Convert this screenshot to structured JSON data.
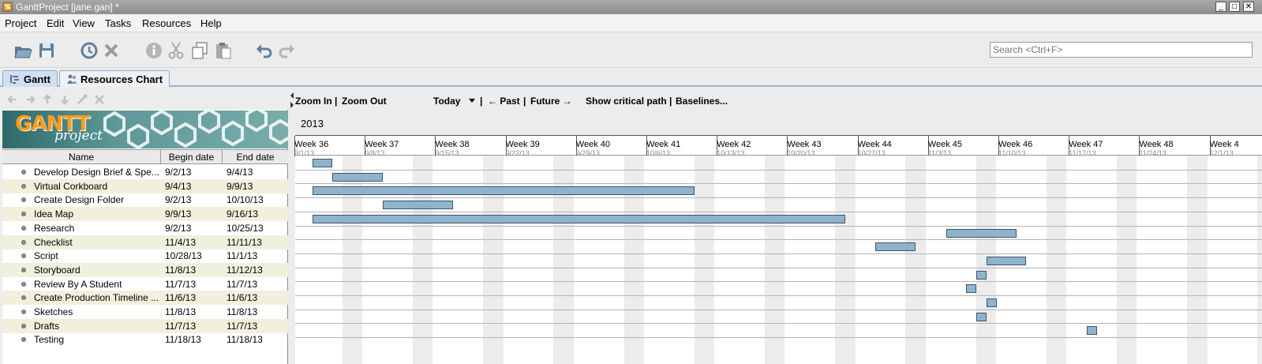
{
  "window": {
    "title": "GanttProject [jane.gan] *",
    "controls": [
      "_",
      "□",
      "✕"
    ]
  },
  "menu": [
    "Project",
    "Edit",
    "View",
    "Tasks",
    "Resources",
    "Help"
  ],
  "toolbar": {
    "buttons": [
      "open-icon",
      "save-icon",
      "history-icon",
      "delete-icon",
      "properties-icon",
      "cut-icon",
      "copy-icon",
      "paste-icon",
      "undo-icon",
      "redo-icon"
    ],
    "search_placeholder": "Search <Ctrl+F>"
  },
  "tabs": [
    {
      "label": "Gantt",
      "active": true
    },
    {
      "label": "Resources Chart",
      "active": false
    }
  ],
  "logo": {
    "text1": "GANTT",
    "text2": "project"
  },
  "table": {
    "columns": [
      "Name",
      "Begin date",
      "End date"
    ],
    "rows": [
      {
        "name": "Develop Design Brief & Spe...",
        "begin": "9/2/13",
        "end": "9/4/13"
      },
      {
        "name": "Virtual Corkboard",
        "begin": "9/4/13",
        "end": "9/9/13"
      },
      {
        "name": "Create Design Folder",
        "begin": "9/2/13",
        "end": "10/10/13"
      },
      {
        "name": "Idea Map",
        "begin": "9/9/13",
        "end": "9/16/13"
      },
      {
        "name": "Research",
        "begin": "9/2/13",
        "end": "10/25/13"
      },
      {
        "name": "Checklist",
        "begin": "11/4/13",
        "end": "11/11/13"
      },
      {
        "name": "Script",
        "begin": "10/28/13",
        "end": "11/1/13"
      },
      {
        "name": "Storyboard",
        "begin": "11/8/13",
        "end": "11/12/13"
      },
      {
        "name": "Review By A Student",
        "begin": "11/7/13",
        "end": "11/7/13"
      },
      {
        "name": "Create Production Timeline ...",
        "begin": "11/6/13",
        "end": "11/6/13"
      },
      {
        "name": "Sketches",
        "begin": "11/8/13",
        "end": "11/8/13"
      },
      {
        "name": "Drafts",
        "begin": "11/7/13",
        "end": "11/7/13"
      },
      {
        "name": "Testing",
        "begin": "11/18/13",
        "end": "11/18/13"
      }
    ]
  },
  "chart_toolbar": {
    "zoom_in": "Zoom In",
    "sep1": "|",
    "zoom_out": "Zoom Out",
    "today": "Today",
    "sep2": "|",
    "past": "← Past",
    "sep3": "|",
    "future": "Future →",
    "critical": "Show critical path",
    "sep4": "|",
    "baselines": "Baselines..."
  },
  "year": "2013",
  "weeks": [
    {
      "label": "Week 36",
      "date": "9/1/13"
    },
    {
      "label": "Week 37",
      "date": "9/8/13"
    },
    {
      "label": "Week 38",
      "date": "9/15/13"
    },
    {
      "label": "Week 39",
      "date": "9/22/13"
    },
    {
      "label": "Week 40",
      "date": "9/29/13"
    },
    {
      "label": "Week 41",
      "date": "10/6/13"
    },
    {
      "label": "Week 42",
      "date": "10/13/13"
    },
    {
      "label": "Week 43",
      "date": "10/20/13"
    },
    {
      "label": "Week 44",
      "date": "10/27/13"
    },
    {
      "label": "Week 45",
      "date": "11/3/13"
    },
    {
      "label": "Week 46",
      "date": "11/10/13"
    },
    {
      "label": "Week 47",
      "date": "11/17/13"
    },
    {
      "label": "Week 48",
      "date": "11/24/13"
    },
    {
      "label": "Week 4",
      "date": "12/1/13"
    }
  ],
  "colors": {
    "bar": "#8fb3cd",
    "bar_border": "#3a556d",
    "weekend": "#ececec",
    "alt_row": "#f0f0dc"
  }
}
